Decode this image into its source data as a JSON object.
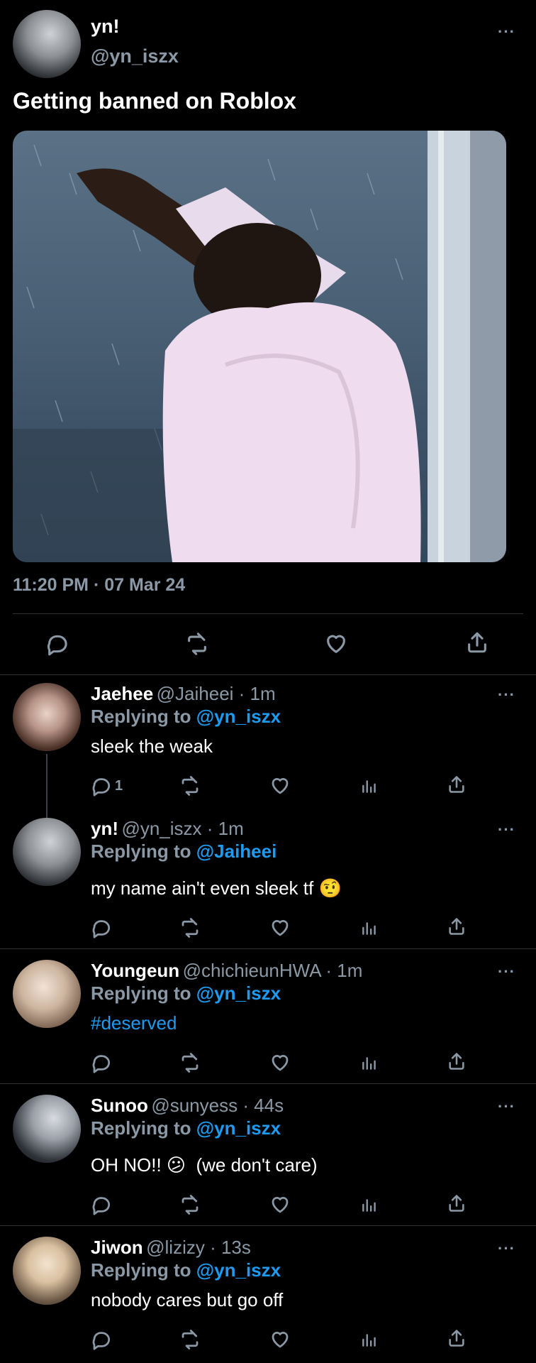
{
  "main_tweet": {
    "name": "yn!",
    "handle": "@yn_iszx",
    "text": "Getting banned on Roblox",
    "timestamp": "11:20 PM · 07 Mar 24",
    "more": "···"
  },
  "replies": [
    {
      "name": "Jaehee",
      "handle_time": "@Jaiheei · 1m",
      "replying_prefix": "Replying to",
      "replying_mention": "@yn_iszx",
      "text": "sleek the weak",
      "reply_count": "1",
      "more": "···"
    },
    {
      "name": "yn!",
      "handle_time": "@yn_iszx · 1m",
      "replying_prefix": "Replying to",
      "replying_mention": "@Jaiheei",
      "text": "my name ain't even sleek tf 🤨",
      "more": "···"
    },
    {
      "name": "Youngeun",
      "handle_time": "@chichieunHWA · 1m",
      "replying_prefix": "Replying to",
      "replying_mention": "@yn_iszx",
      "text": "#deserved",
      "more": "···"
    },
    {
      "name": "Sunoo",
      "handle_time": "@sunyess · 44s",
      "replying_prefix": "Replying to",
      "replying_mention": "@yn_iszx",
      "text": "OH NO!! 😕  (we don't care)",
      "more": "···"
    },
    {
      "name": "Jiwon",
      "handle_time": "@lizizy · 13s",
      "replying_prefix": "Replying to",
      "replying_mention": "@yn_iszx",
      "text": "nobody cares but go off",
      "more": "···"
    }
  ],
  "colors": {
    "background": "#000000",
    "accent": "#1d9bf0",
    "secondary_text": "#8b98a5",
    "divider": "#2f3336"
  },
  "icons": [
    "reply-icon",
    "retweet-icon",
    "like-icon",
    "views-icon",
    "share-icon",
    "more-icon"
  ]
}
